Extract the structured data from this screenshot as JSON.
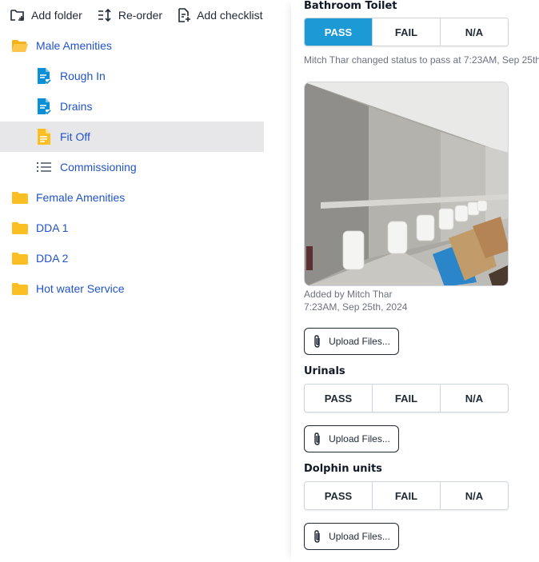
{
  "toolbar": {
    "add_folder": "Add folder",
    "reorder": "Re-order",
    "add_checklist": "Add checklist"
  },
  "tree": {
    "male_amenities": "Male Amenities",
    "rough_in": "Rough In",
    "drains": "Drains",
    "fit_off": "Fit Off",
    "commissioning": "Commissioning",
    "female_amenities": "Female Amenities",
    "dda1": "DDA 1",
    "dda2": "DDA 2",
    "hot_water": "Hot water Service"
  },
  "checklist": {
    "bathroom_toilet": {
      "title": "Bathroom Toilet",
      "selected": "PASS",
      "status_log": "Mitch Thar changed status to pass at 7:23AM, Sep 25th,",
      "photo_added_by": "Added by Mitch Thar",
      "photo_time": "7:23AM, Sep 25th, 2024"
    },
    "urinals": {
      "title": "Urinals"
    },
    "dolphin_units": {
      "title": "Dolphin units"
    },
    "options": {
      "pass": "PASS",
      "fail": "FAIL",
      "na": "N/A"
    },
    "upload_label": "Upload Files..."
  },
  "colors": {
    "accent": "#1c9ad6",
    "link": "#2153c7",
    "folder": "#fbbf24",
    "doc_blue": "#0b8fd6",
    "selected_bg": "#e7e7ea"
  },
  "icons": {
    "add_folder": "add-folder-icon",
    "reorder": "reorder-icon",
    "add_checklist": "add-checklist-icon",
    "folder_open": "folder-open-icon",
    "folder": "folder-icon",
    "checked_doc": "checked-document-icon",
    "doc": "document-icon",
    "list": "list-icon",
    "paperclip": "paperclip-icon"
  }
}
